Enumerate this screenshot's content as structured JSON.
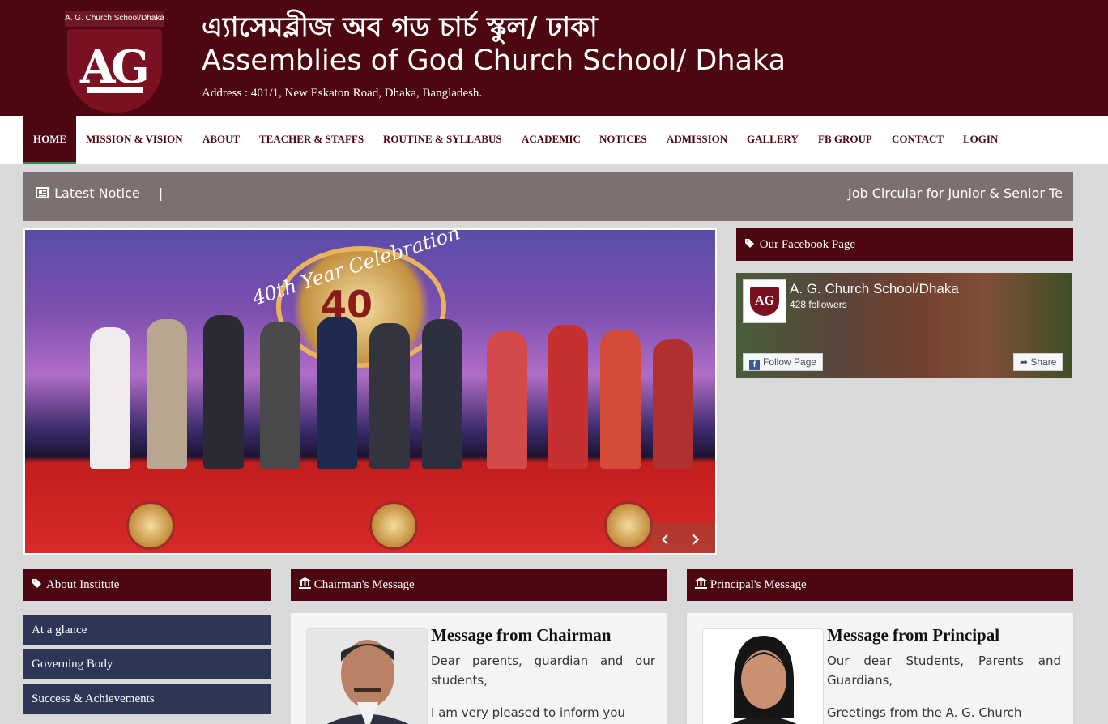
{
  "header": {
    "logo_text": "A. G. Church School/Dhaka",
    "logo_monogram": "AG",
    "title_bn": "এ্যাসেমব্লীজ অব গড চার্চ স্কুল/ ঢাকা",
    "title_en": "Assemblies of God Church School/ Dhaka",
    "address": "Address : 401/1, New Eskaton Road, Dhaka, Bangladesh."
  },
  "nav": {
    "items": [
      "HOME",
      "MISSION & VISION",
      "ABOUT",
      "TEACHER & STAFFS",
      "ROUTINE & SYLLABUS",
      "ACADEMIC",
      "NOTICES",
      "ADMISSION",
      "GALLERY",
      "FB GROUP",
      "CONTACT",
      "LOGIN"
    ],
    "active": "HOME"
  },
  "notice": {
    "label": "Latest Notice",
    "separator": "|",
    "ticker": "Job Circular for Junior & Senior Te"
  },
  "slider": {
    "banner_text": "40th Year Celebration",
    "badge_number": "40",
    "prev": "‹",
    "next": "›"
  },
  "facebook": {
    "heading": "Our Facebook Page",
    "page_name": "A. G. Church School/Dhaka",
    "followers": "428 followers",
    "follow_button": "Follow Page",
    "share_button": "Share"
  },
  "about": {
    "heading": "About Institute",
    "links": [
      "At a glance",
      "Governing Body",
      "Success & Achievements"
    ]
  },
  "chairman": {
    "heading": "Chairman's Message",
    "title": "Message from Chairman",
    "greeting": "Dear parents, guardian and our students,",
    "text": "I am very pleased to inform you"
  },
  "principal": {
    "heading": "Principal's Message",
    "title": "Message from Principal",
    "greeting": "Our dear Students, Parents and Guardians,",
    "text": "Greetings from the A. G. Church"
  },
  "colors": {
    "primary": "#4d0710",
    "sidebar_link": "#2d3656",
    "notice_bg": "#7c7070",
    "page_bg": "#d9d9d9"
  }
}
